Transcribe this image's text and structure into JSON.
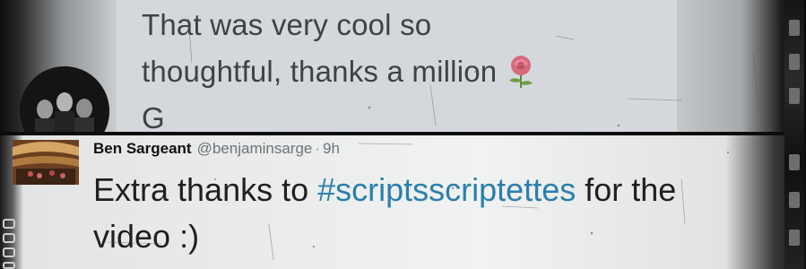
{
  "top_tweet": {
    "lines": [
      "That was very cool so",
      "thoughtful, thanks a million",
      "G"
    ],
    "emoji": "rose-icon"
  },
  "bottom_tweet": {
    "display_name": "Ben Sargeant",
    "handle": "@benjaminsarge",
    "separator": "·",
    "time": "9h",
    "text_before": "Extra thanks to ",
    "hashtag": "#scriptsscriptettes",
    "text_after": " for the",
    "line2": "video :)"
  },
  "colors": {
    "hashtag": "#2a7fae",
    "top_text": "#3e4247",
    "body_text": "#1f1f1f",
    "meta_text": "#6e7378"
  }
}
